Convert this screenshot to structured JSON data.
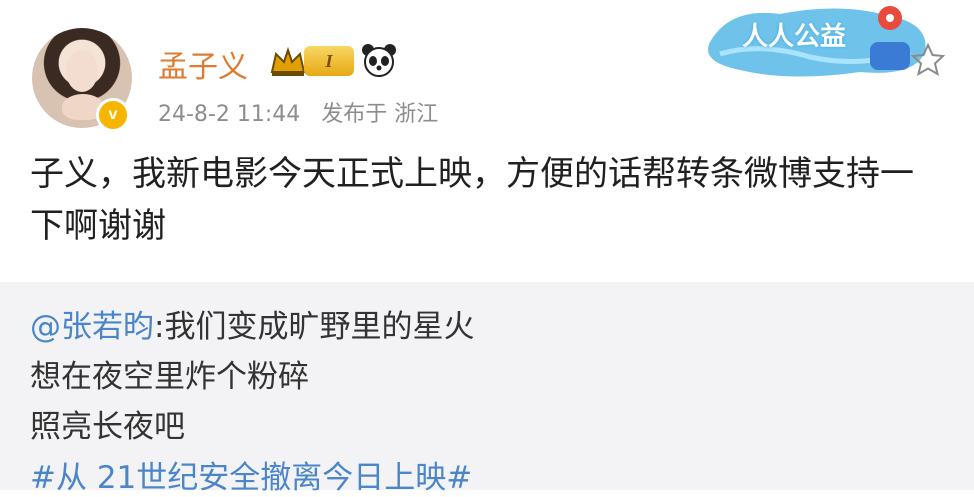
{
  "post": {
    "username": "孟子义",
    "level": "I",
    "date": "24-8-2 11:44",
    "published_from": "发布于 浙江",
    "content": "子义，我新电影今天正式上映，方便的话帮转条微博支持一下啊谢谢"
  },
  "promo": {
    "label": "人人公益"
  },
  "repost": {
    "mention": "@张若昀",
    "line1": ":我们变成旷野里的星火",
    "line2": "想在夜空里炸个粉碎",
    "line3": "照亮长夜吧",
    "hashtag": "#从 21世纪安全撤离今日上映#"
  },
  "colors": {
    "username": "#e07a2f",
    "link": "#4a86c9"
  },
  "icons": {
    "verified": "verified-icon",
    "crown": "crown-icon",
    "panda": "panda-icon",
    "favorite": "star-icon"
  }
}
